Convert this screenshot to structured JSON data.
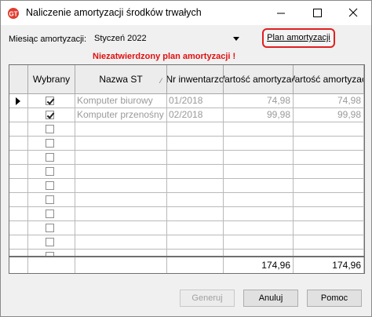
{
  "window": {
    "title": "Naliczenie amortyzacji środków trwałych"
  },
  "filter": {
    "month_label": "Miesiąc amortyzacji:",
    "month_value": "Styczeń 2022",
    "plan_button": "Plan amortyzacji"
  },
  "warning": "Niezatwierdzony plan amortyzacji !",
  "table": {
    "headers": {
      "selected": "Wybrany",
      "name": "Nazwa ST",
      "inventory": "Nr inwentarzo",
      "value1": "Wartość amortyzacji",
      "value2": "Wartość amortyzacji"
    },
    "rows": [
      {
        "checked": true,
        "name": "Komputer biurowy",
        "inventory": "01/2018",
        "value1": "74,98",
        "value2": "74,98"
      },
      {
        "checked": true,
        "name": "Komputer przenośny",
        "inventory": "02/2018",
        "value1": "99,98",
        "value2": "99,98"
      }
    ],
    "empty_rows": 10
  },
  "totals": {
    "value1": "174,96",
    "value2": "174,96"
  },
  "buttons": {
    "generate": "Generuj",
    "cancel": "Anuluj",
    "help": "Pomoc"
  }
}
